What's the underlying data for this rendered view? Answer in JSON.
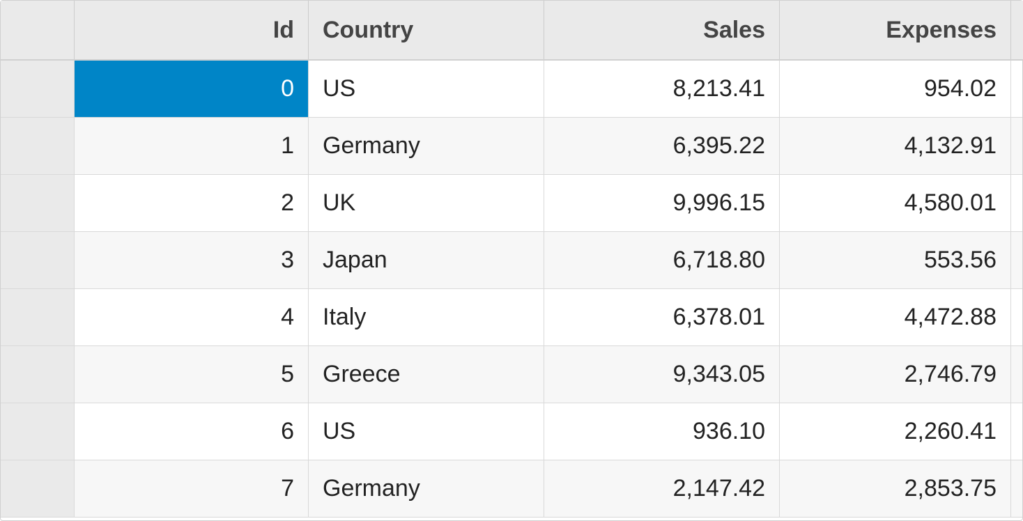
{
  "grid": {
    "columns": {
      "id": "Id",
      "country": "Country",
      "sales": "Sales",
      "expenses": "Expenses"
    },
    "rows": [
      {
        "id": "0",
        "country": "US",
        "sales": "8,213.41",
        "expenses": "954.02"
      },
      {
        "id": "1",
        "country": "Germany",
        "sales": "6,395.22",
        "expenses": "4,132.91"
      },
      {
        "id": "2",
        "country": "UK",
        "sales": "9,996.15",
        "expenses": "4,580.01"
      },
      {
        "id": "3",
        "country": "Japan",
        "sales": "6,718.80",
        "expenses": "553.56"
      },
      {
        "id": "4",
        "country": "Italy",
        "sales": "6,378.01",
        "expenses": "4,472.88"
      },
      {
        "id": "5",
        "country": "Greece",
        "sales": "9,343.05",
        "expenses": "2,746.79"
      },
      {
        "id": "6",
        "country": "US",
        "sales": "936.10",
        "expenses": "2,260.41"
      },
      {
        "id": "7",
        "country": "Germany",
        "sales": "2,147.42",
        "expenses": "2,853.75"
      }
    ],
    "selected": {
      "row": 0,
      "col": "id"
    }
  }
}
